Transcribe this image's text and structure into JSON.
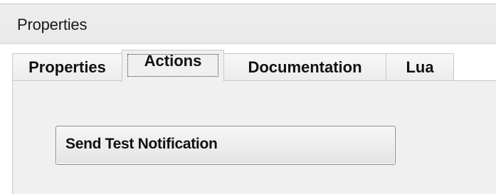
{
  "panel": {
    "title": "Properties"
  },
  "tabs": [
    {
      "label": "Properties",
      "selected": false
    },
    {
      "label": "Actions",
      "selected": true
    },
    {
      "label": "Documentation",
      "selected": false
    },
    {
      "label": "Lua",
      "selected": false
    }
  ],
  "actions": {
    "send_test_notification_label": "Send Test Notification"
  }
}
